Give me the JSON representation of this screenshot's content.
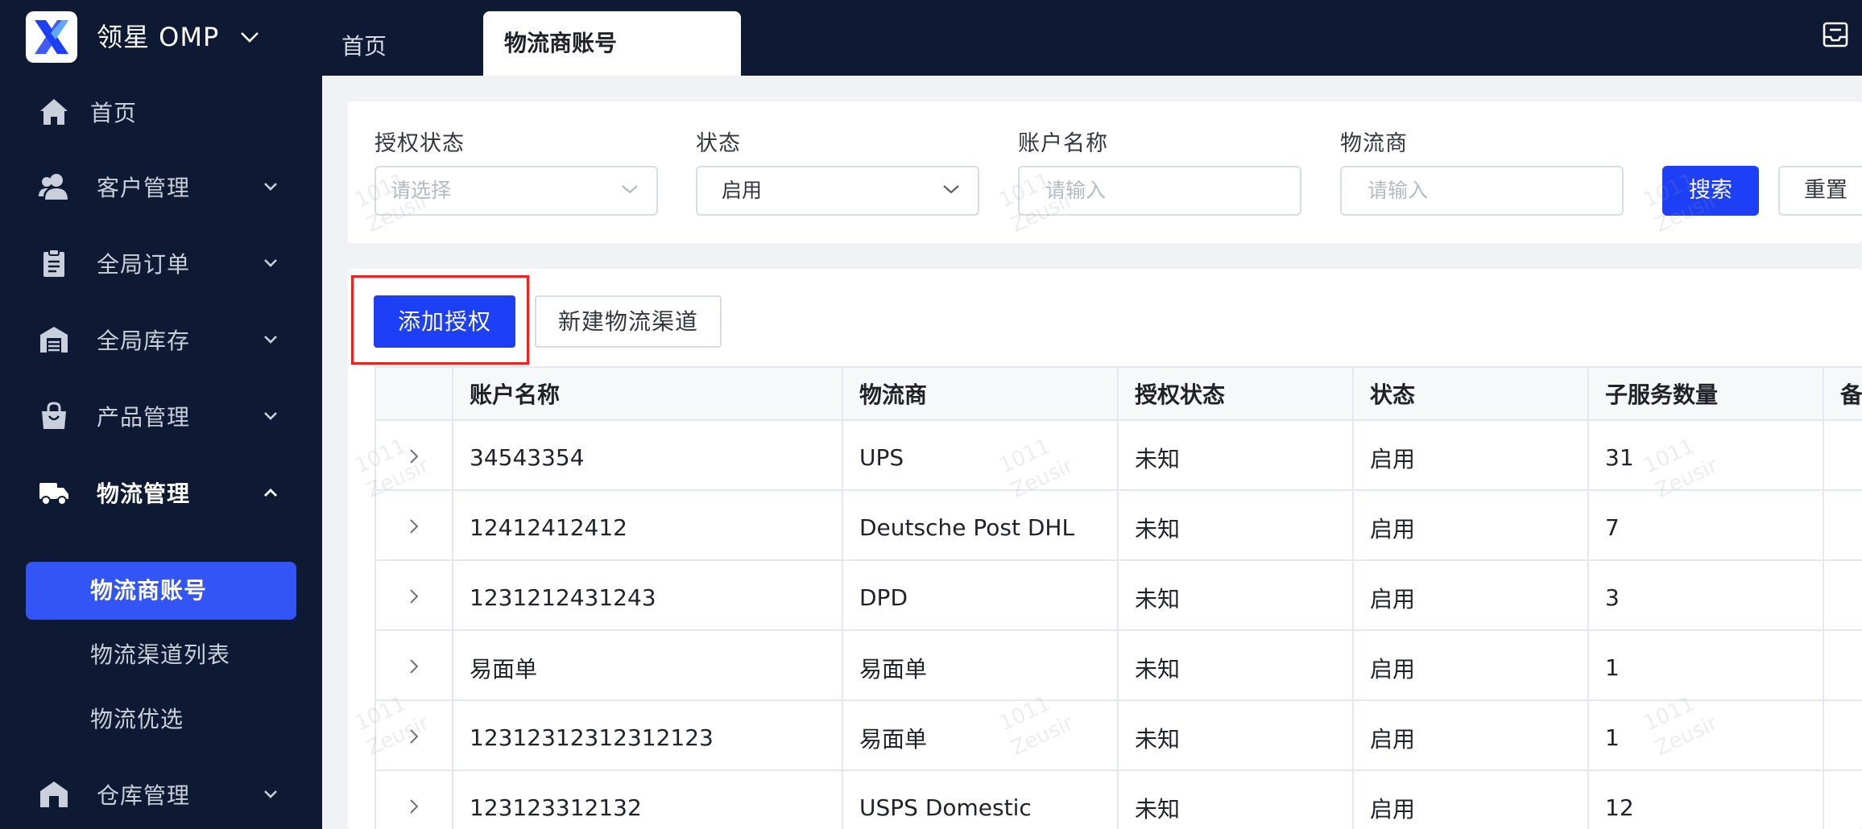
{
  "app": {
    "title": "领星 OMP",
    "accent_color": "#1d3ff5",
    "nav_bg": "#0e1a33"
  },
  "top_tabs": [
    {
      "label": "首页",
      "active": false
    },
    {
      "label": "物流商账号",
      "active": true
    }
  ],
  "sidebar": {
    "items": [
      {
        "label": "首页",
        "icon": "home-icon"
      },
      {
        "label": "客户管理",
        "icon": "users-icon"
      },
      {
        "label": "全局订单",
        "icon": "clipboard-icon"
      },
      {
        "label": "全局库存",
        "icon": "warehouse-icon"
      },
      {
        "label": "产品管理",
        "icon": "shopping-bag-icon"
      },
      {
        "label": "物流管理",
        "icon": "truck-icon",
        "expanded": true
      },
      {
        "label": "仓库管理",
        "icon": "storehouse-icon"
      }
    ],
    "sub_items": [
      {
        "label": "物流商账号",
        "active": true
      },
      {
        "label": "物流渠道列表",
        "active": false
      },
      {
        "label": "物流优选",
        "active": false
      }
    ]
  },
  "filters": {
    "auth_status": {
      "label": "授权状态",
      "placeholder": "请选择"
    },
    "status": {
      "label": "状态",
      "value": "启用"
    },
    "account_name": {
      "label": "账户名称",
      "placeholder": "请输入"
    },
    "carrier": {
      "label": "物流商",
      "placeholder": "请输入"
    },
    "search_label": "搜索",
    "reset_label": "重置"
  },
  "actions": {
    "add_auth_label": "添加授权",
    "new_channel_label": "新建物流渠道"
  },
  "table": {
    "columns": [
      "",
      "账户名称",
      "物流商",
      "授权状态",
      "状态",
      "子服务数量",
      "备"
    ],
    "rows": [
      [
        "34543354",
        "UPS",
        "未知",
        "启用",
        "31"
      ],
      [
        "12412412412",
        "Deutsche Post DHL",
        "未知",
        "启用",
        "7"
      ],
      [
        "1231212431243",
        "DPD",
        "未知",
        "启用",
        "3"
      ],
      [
        "易面单",
        "易面单",
        "未知",
        "启用",
        "1"
      ],
      [
        "12312312312312123",
        "易面单",
        "未知",
        "启用",
        "1"
      ],
      [
        "123123312132",
        "USPS Domestic",
        "未知",
        "启用",
        "12"
      ]
    ]
  },
  "watermark": {
    "line1": "1011",
    "line2": "Zeusir"
  }
}
